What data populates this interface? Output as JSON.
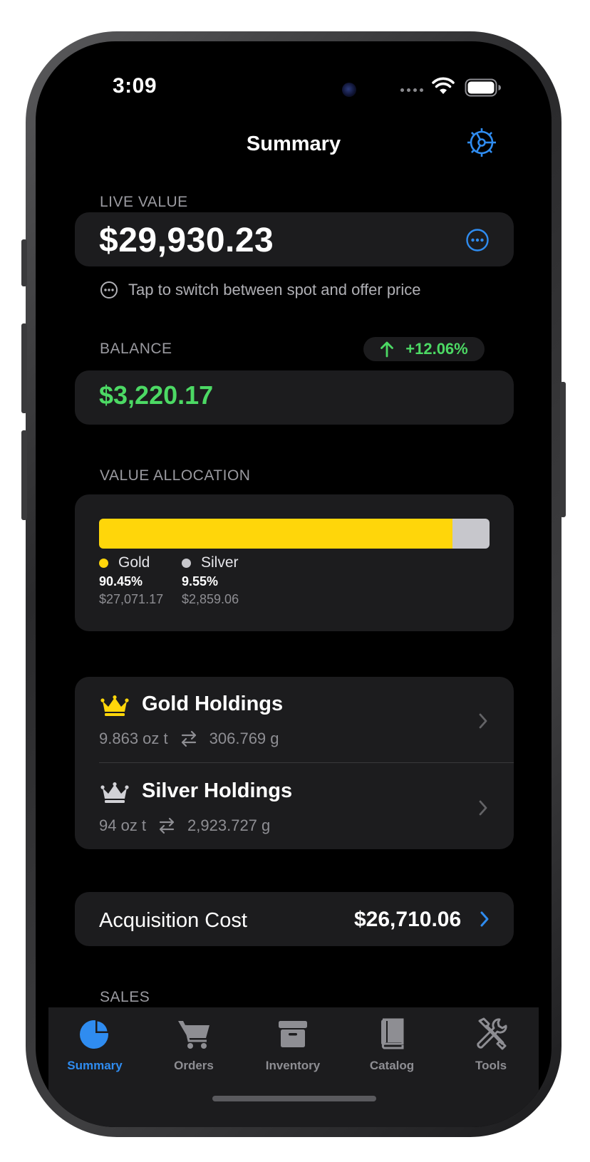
{
  "status_bar": {
    "time": "3:09"
  },
  "nav": {
    "title": "Summary"
  },
  "live_value": {
    "label": "LIVE VALUE",
    "amount": "$29,930.23",
    "hint": "Tap to switch between spot and offer price"
  },
  "balance": {
    "label": "BALANCE",
    "amount": "$3,220.17",
    "change": "+12.06%"
  },
  "allocation": {
    "label": "VALUE ALLOCATION",
    "gold_fraction": 0.9045,
    "silver_fraction": 0.0955,
    "items": [
      {
        "name": "Gold",
        "percent": "90.45%",
        "amount": "$27,071.17",
        "color": "#ffd60a"
      },
      {
        "name": "Silver",
        "percent": "9.55%",
        "amount": "$2,859.06",
        "color": "#c7c7cc"
      }
    ]
  },
  "holdings": [
    {
      "title": "Gold Holdings",
      "oz": "9.863 oz t",
      "grams": "306.769 g",
      "icon": "gold-crown-icon"
    },
    {
      "title": "Silver Holdings",
      "oz": "94 oz t",
      "grams": "2,923.727 g",
      "icon": "silver-crown-icon"
    }
  ],
  "acquisition": {
    "label": "Acquisition Cost",
    "value": "$26,710.06"
  },
  "sales": {
    "label": "SALES"
  },
  "tabs": [
    {
      "label": "Summary",
      "icon": "pie-chart-icon",
      "active": true
    },
    {
      "label": "Orders",
      "icon": "cart-icon",
      "active": false
    },
    {
      "label": "Inventory",
      "icon": "archive-box-icon",
      "active": false
    },
    {
      "label": "Catalog",
      "icon": "book-icon",
      "active": false
    },
    {
      "label": "Tools",
      "icon": "tools-icon",
      "active": false
    }
  ],
  "colors": {
    "accent": "#2f8cf0",
    "positive": "#4cd964",
    "gold": "#ffd60a",
    "silver": "#c7c7cc",
    "card": "#1c1c1e"
  }
}
